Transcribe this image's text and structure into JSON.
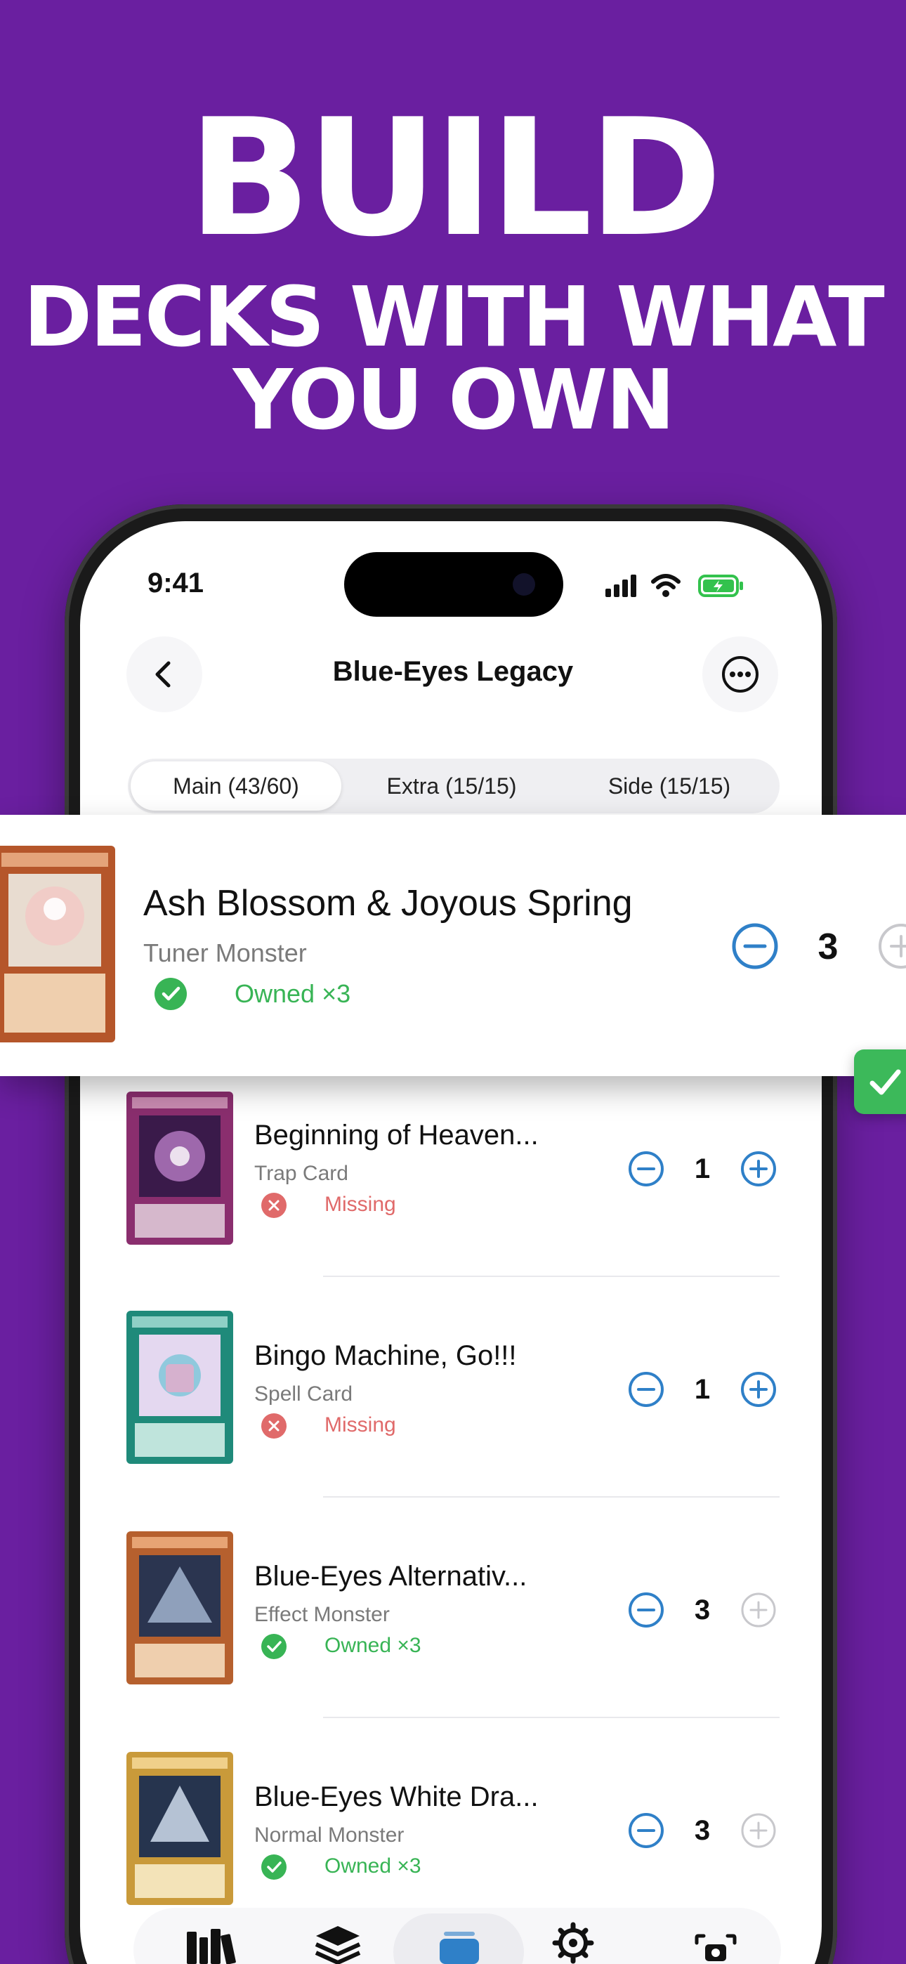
{
  "headline": {
    "line1": "BUILD",
    "line2": "DECKS WITH WHAT",
    "line3": "YOU OWN"
  },
  "status_bar": {
    "time": "9:41"
  },
  "nav": {
    "title": "Blue-Eyes Legacy",
    "back_icon": "chevron-left-icon",
    "more_icon": "ellipsis-icon"
  },
  "tabs": [
    {
      "label": "Main (43/60)",
      "active": true
    },
    {
      "label": "Extra (15/15)",
      "active": false
    },
    {
      "label": "Side (15/15)",
      "active": false
    }
  ],
  "highlight_card": {
    "name": "Ash Blossom & Joyous Spring",
    "type": "Tuner Monster",
    "status": "Owned ×3",
    "owned": true,
    "quantity": "3"
  },
  "cards": [
    {
      "name": "Beginning of Heaven...",
      "type": "Trap Card",
      "status": "Missing",
      "owned": false,
      "quantity": "1",
      "plus_enabled": true
    },
    {
      "name": "Bingo Machine, Go!!!",
      "type": "Spell Card",
      "status": "Missing",
      "owned": false,
      "quantity": "1",
      "plus_enabled": true
    },
    {
      "name": "Blue-Eyes Alternativ...",
      "type": "Effect Monster",
      "status": "Owned ×3",
      "owned": true,
      "quantity": "3",
      "plus_enabled": false
    },
    {
      "name": "Blue-Eyes White Dra...",
      "type": "Normal Monster",
      "status": "Owned ×3",
      "owned": true,
      "quantity": "3",
      "plus_enabled": false
    }
  ],
  "tab_bar": {
    "items": [
      "books-icon",
      "stack-icon",
      "deck-icon",
      "gear-icon"
    ],
    "active_index": 2,
    "scan_icon": "camera-scan-icon"
  },
  "colors": {
    "background": "#6a1fa0",
    "accent": "#2f80c8",
    "owned": "#38b455",
    "missing": "#e06a6a"
  }
}
